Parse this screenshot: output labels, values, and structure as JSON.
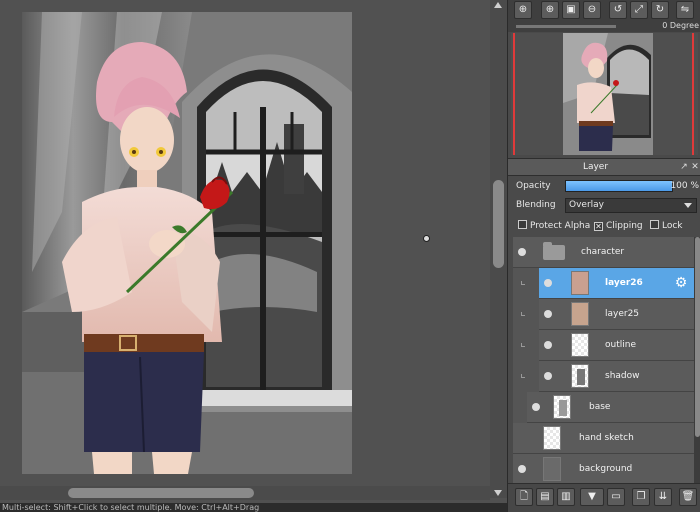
{
  "status_bar": {
    "text": "Multi-select: Shift+Click to select multiple. Move: Ctrl+Alt+Drag"
  },
  "navigator": {
    "toolbar": [
      {
        "name": "zoom-fit-icon",
        "glyph": "⊕"
      },
      {
        "name": "zoom-in-icon",
        "glyph": "⊕"
      },
      {
        "name": "fit-window-icon",
        "glyph": "▣"
      },
      {
        "name": "zoom-out-icon",
        "glyph": "⊖"
      },
      {
        "name": "rotate-left-icon",
        "glyph": "↺"
      },
      {
        "name": "fullscreen-icon",
        "glyph": "⤢"
      },
      {
        "name": "rotate-right-icon",
        "glyph": "↻"
      },
      {
        "name": "flip-icon",
        "glyph": "⇋"
      }
    ],
    "rotation_label": "0 Degree"
  },
  "layer_panel": {
    "title": "Layer",
    "opacity_label": "Opacity",
    "opacity_value": "100 %",
    "opacity_fraction": 1.0,
    "blending_label": "Blending",
    "blending_value": "Overlay",
    "options": [
      {
        "label": "Protect Alpha",
        "checked": false
      },
      {
        "label": "Clipping",
        "checked": true
      },
      {
        "label": "Lock",
        "checked": false
      }
    ],
    "layers": [
      {
        "name": "character",
        "type": "folder",
        "visible": true
      },
      {
        "name": "layer26",
        "type": "layer",
        "visible": true,
        "selected": true
      },
      {
        "name": "layer25",
        "type": "layer",
        "visible": true
      },
      {
        "name": "outline",
        "type": "layer",
        "visible": true
      },
      {
        "name": "shadow",
        "type": "layer",
        "visible": true
      },
      {
        "name": "base",
        "type": "layer",
        "visible": true
      },
      {
        "name": "hand sketch",
        "type": "layer",
        "visible": false
      },
      {
        "name": "background",
        "type": "layer",
        "visible": true
      }
    ],
    "toolbar": [
      {
        "name": "new-layer-icon",
        "glyph": "🗋"
      },
      {
        "name": "new-halftone-layer-icon",
        "glyph": "▤"
      },
      {
        "name": "new-1bit-layer-icon",
        "glyph": "▥"
      },
      {
        "name": "add-special-layer-icon",
        "glyph": "▼"
      },
      {
        "name": "new-folder-icon",
        "glyph": "▭"
      },
      {
        "name": "duplicate-layer-icon",
        "glyph": "❐"
      },
      {
        "name": "merge-down-icon",
        "glyph": "⇊"
      },
      {
        "name": "delete-layer-icon",
        "glyph": "🗑"
      }
    ]
  }
}
